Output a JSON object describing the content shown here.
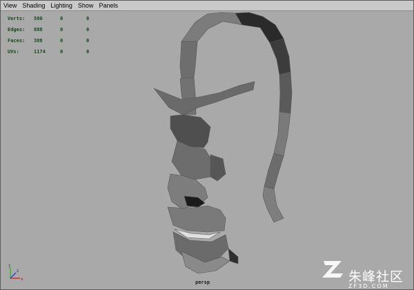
{
  "menubar": {
    "items": [
      "View",
      "Shading",
      "Lighting",
      "Show",
      "Panels"
    ]
  },
  "hud": {
    "rows": [
      {
        "label": "Verts:",
        "values": [
          "500",
          "0",
          "0"
        ]
      },
      {
        "label": "Edges:",
        "values": [
          "888",
          "0",
          "0"
        ]
      },
      {
        "label": "Faces:",
        "values": [
          "388",
          "0",
          "0"
        ]
      },
      {
        "label": "UVs:",
        "values": [
          "1174",
          "0",
          "0"
        ]
      }
    ]
  },
  "camera_label": "persp",
  "watermark": {
    "text": "朱峰社区",
    "subtext": "ZF3D.COM"
  },
  "colors": {
    "viewport_bg": "#a9a9a9",
    "hud_text": "#15491b",
    "menubar_bg": "#c9c9c9"
  }
}
